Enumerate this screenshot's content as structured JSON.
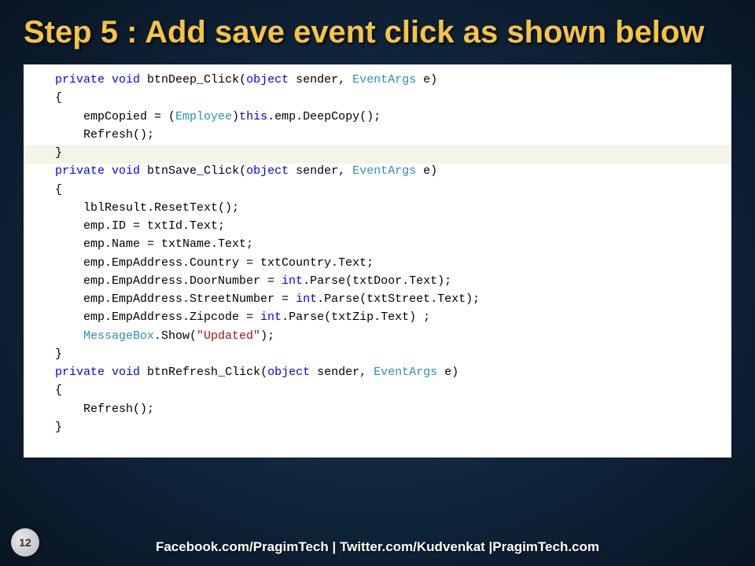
{
  "title": "Step 5 : Add save event click as shown below",
  "page_number": "12",
  "footer": "Facebook.com/PragimTech | Twitter.com/Kudvenkat |PragimTech.com",
  "code": {
    "l1": {
      "kw1": "private",
      "kw2": "void",
      "name": " btnDeep_Click(",
      "kw3": "object",
      "mid": " sender, ",
      "type": "EventArgs",
      "end": " e)"
    },
    "l2": "{",
    "l3_a": "    empCopied = (",
    "l3_type": "Employee",
    "l3_b": ")",
    "l3_kw": "this",
    "l3_c": ".emp.DeepCopy();",
    "l4": "    Refresh();",
    "l5": "}",
    "l6": {
      "kw1": "private",
      "kw2": "void",
      "name": " btnSave_Click(",
      "kw3": "object",
      "mid": " sender, ",
      "type": "EventArgs",
      "end": " e)"
    },
    "l7": "{",
    "l8": "    lblResult.ResetText();",
    "l9": "    emp.ID = txtId.Text;",
    "l10": "    emp.Name = txtName.Text;",
    "l11": "    emp.EmpAddress.Country = txtCountry.Text;",
    "l12_a": "    emp.EmpAddress.DoorNumber = ",
    "l12_kw": "int",
    "l12_b": ".Parse(txtDoor.Text);",
    "l13_a": "    emp.EmpAddress.StreetNumber = ",
    "l13_kw": "int",
    "l13_b": ".Parse(txtStreet.Text);",
    "l14_a": "    emp.EmpAddress.Zipcode = ",
    "l14_kw": "int",
    "l14_b": ".Parse(txtZip.Text) ;",
    "l15_a": "    ",
    "l15_type": "MessageBox",
    "l15_b": ".Show(",
    "l15_str": "\"Updated\"",
    "l15_c": ");",
    "l16": "}",
    "l17": {
      "kw1": "private",
      "kw2": "void",
      "name": " btnRefresh_Click(",
      "kw3": "object",
      "mid": " sender, ",
      "type": "EventArgs",
      "end": " e)"
    },
    "l18": "{",
    "l19": "    Refresh();",
    "l20": "}"
  }
}
